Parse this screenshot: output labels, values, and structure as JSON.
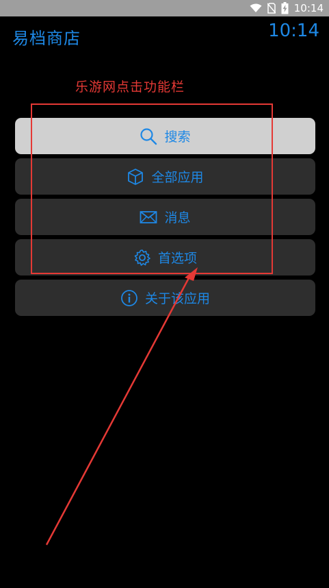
{
  "status_bar": {
    "time": "10:14",
    "icons": [
      "wifi-icon",
      "sim-off-icon",
      "battery-charging-icon"
    ]
  },
  "header": {
    "title": "易档商店",
    "clock": "10:14"
  },
  "annotation": {
    "caption": "乐游网点击功能栏",
    "color": "#e53935"
  },
  "menu": {
    "items": [
      {
        "label": "搜索",
        "icon": "search-icon",
        "active": true
      },
      {
        "label": "全部应用",
        "icon": "cube-icon",
        "active": false
      },
      {
        "label": "消息",
        "icon": "envelope-icon",
        "active": false
      },
      {
        "label": "首选项",
        "icon": "gear-icon",
        "active": false
      },
      {
        "label": "关于该应用",
        "icon": "info-icon",
        "active": false
      }
    ]
  },
  "colors": {
    "background": "#000000",
    "accent": "#1e88e5",
    "button": "#2e2e2e",
    "button_active": "#d0d0d0",
    "status_bar": "#9e9e9e"
  }
}
